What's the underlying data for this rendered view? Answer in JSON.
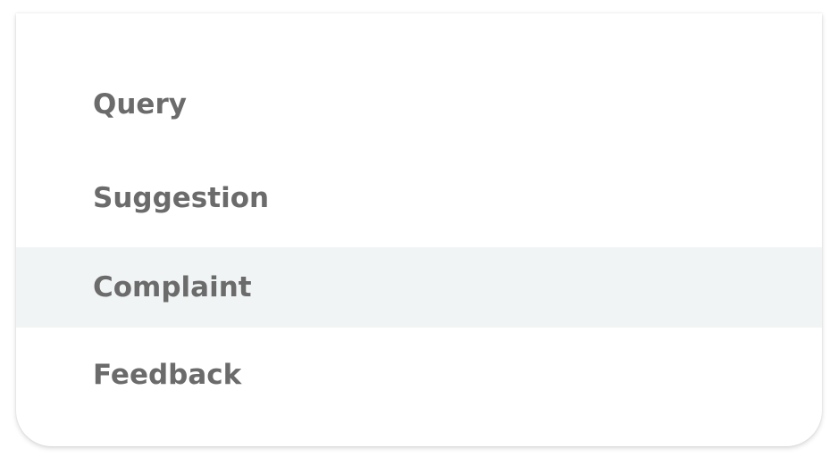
{
  "menu": {
    "items": [
      {
        "label": "Query",
        "highlighted": false
      },
      {
        "label": "Suggestion",
        "highlighted": false
      },
      {
        "label": "Complaint",
        "highlighted": true
      },
      {
        "label": "Feedback",
        "highlighted": false
      }
    ],
    "highlight_color": "#f1f4f5",
    "text_color": "#6b6b6b"
  }
}
